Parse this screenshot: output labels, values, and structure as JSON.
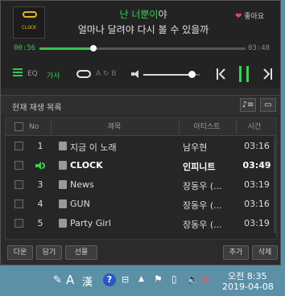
{
  "player": {
    "album_logo_text": "CLOCK",
    "lyric_line1_highlight": "난 너뿐이",
    "lyric_line1_rest": "야",
    "lyric_line2": "얼마나 달려야 다시 볼 수 있을까",
    "like_label": "좋아요",
    "current_time": "00:56",
    "total_time": "03:48",
    "progress_fraction": 0.26,
    "volume_fraction": 0.85,
    "eq_label": "EQ",
    "lyrics_label": "가사",
    "ab_label": "A ↻ B"
  },
  "playlist": {
    "title": "현재 재생 목록",
    "columns": {
      "no": "No",
      "title": "제목",
      "artist": "아티스트",
      "time": "시간"
    },
    "rows": [
      {
        "no": "1",
        "title": "지금 이 노래",
        "artist": "남우현",
        "time": "03:16",
        "active": false
      },
      {
        "no": "",
        "title": "CLOCK",
        "artist": "인피니트",
        "time": "03:49",
        "active": true
      },
      {
        "no": "3",
        "title": "News",
        "artist": "장동우 (...",
        "time": "03:19",
        "active": false
      },
      {
        "no": "4",
        "title": "GUN",
        "artist": "장동우 (...",
        "time": "03:16",
        "active": false
      },
      {
        "no": "5",
        "title": "Party Girl",
        "artist": "장동우 (...",
        "time": "03:19",
        "active": false
      }
    ]
  },
  "buttons": {
    "download": "다운",
    "save": "담기",
    "gift": "선물",
    "add": "추가",
    "delete": "삭제"
  },
  "taskbar": {
    "ime_a": "A",
    "ime_han": "漢",
    "help": "?",
    "time": "오전 8:35",
    "date": "2019-04-08"
  },
  "colors": {
    "accent": "#39d353",
    "heart": "#e2465a"
  }
}
